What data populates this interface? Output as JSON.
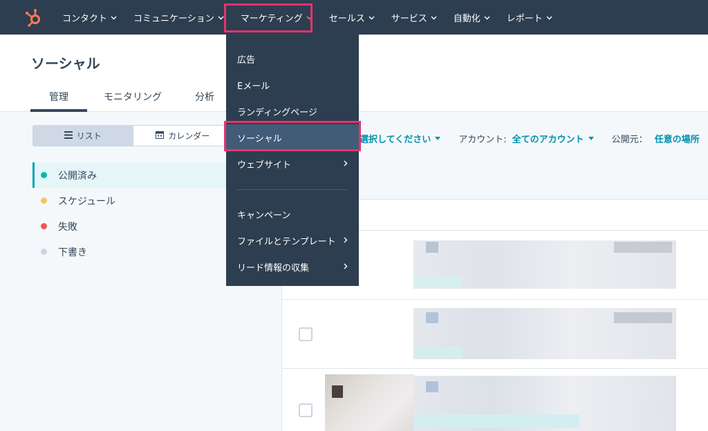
{
  "nav": {
    "items": [
      {
        "label": "コンタクト"
      },
      {
        "label": "コミュニケーション"
      },
      {
        "label": "マーケティング"
      },
      {
        "label": "セールス"
      },
      {
        "label": "サービス"
      },
      {
        "label": "自動化"
      },
      {
        "label": "レポート"
      }
    ]
  },
  "page": {
    "title": "ソーシャル",
    "tabs": [
      {
        "label": "管理"
      },
      {
        "label": "モニタリング"
      },
      {
        "label": "分析"
      }
    ]
  },
  "view_toggle": {
    "list_label": "リスト",
    "calendar_label": "カレンダー"
  },
  "status": {
    "items": [
      {
        "label": "公開済み",
        "color": "#00bda5"
      },
      {
        "label": "スケジュール",
        "color": "#f5c26b"
      },
      {
        "label": "失敗",
        "color": "#f2545b"
      },
      {
        "label": "下書き",
        "color": "#cbd6e2"
      }
    ]
  },
  "filters": {
    "first_value": "選択してください",
    "account_label": "アカウント:",
    "account_value": "全てのアカウント",
    "publisher_label": "公開元：",
    "publisher_value": "任意の場所"
  },
  "marketing_menu": {
    "items": [
      {
        "label": "広告"
      },
      {
        "label": "Eメール"
      },
      {
        "label": "ランディングページ"
      },
      {
        "label": "ソーシャル"
      },
      {
        "label": "ウェブサイト"
      },
      {
        "label": "キャンペーン"
      },
      {
        "label": "ファイルとテンプレート"
      },
      {
        "label": "リード情報の収集"
      }
    ]
  },
  "colors": {
    "nav_bg": "#2d3e50",
    "accent": "#ff7a59",
    "highlight": "#e8336e",
    "link": "#0091ae"
  }
}
